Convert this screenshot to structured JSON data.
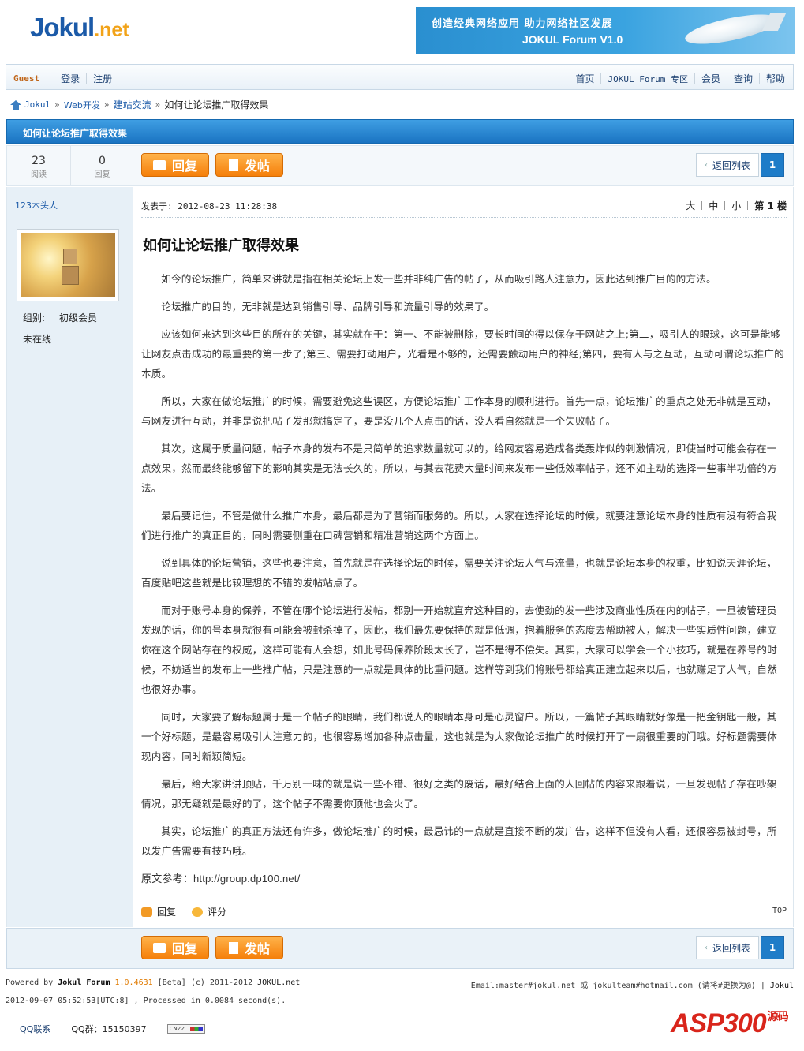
{
  "header": {
    "logo_main": "Jokul",
    "logo_suffix": ".net",
    "banner_line1": "创造经典网络应用   助力网络社区发展",
    "banner_line2": "JOKUL Forum V1.0"
  },
  "navbar": {
    "guest": "Guest",
    "login": "登录",
    "register": "注册",
    "right_items": [
      "首页",
      "JOKUL Forum 专区",
      "会员",
      "查询",
      "帮助"
    ]
  },
  "breadcrumb": {
    "home": "Jokul",
    "items": [
      "Web开发",
      "建站交流"
    ],
    "current": "如何让论坛推广取得效果",
    "separator": "»"
  },
  "thread": {
    "title": "如何让论坛推广取得效果",
    "views": "23",
    "views_label": "阅读",
    "replies": "0",
    "replies_label": "回复",
    "reply_button": "回复",
    "post_button": "发帖",
    "back_button": "返回列表",
    "page": "1"
  },
  "author": {
    "name": "123木头人",
    "group_label": "组别:",
    "group": "初级会员",
    "status": "未在线"
  },
  "post": {
    "meta": "发表于: 2012-08-23 11:28:38",
    "font_big": "大",
    "font_mid": "中",
    "font_small": "小",
    "floor": "第 1 楼",
    "heading": "如何让论坛推广取得效果",
    "paragraphs": [
      "如今的论坛推广，简单来讲就是指在相关论坛上发一些并非纯广告的帖子，从而吸引路人注意力，因此达到推广目的的方法。",
      "论坛推广的目的，无非就是达到销售引导、品牌引导和流量引导的效果了。",
      "应该如何来达到这些目的所在的关键，其实就在于：第一、不能被删除，要长时间的得以保存于网站之上;第二，吸引人的眼球，这可是能够让网友点击成功的最重要的第一步了;第三、需要打动用户，光看是不够的，还需要触动用户的神经;第四，要有人与之互动，互动可谓论坛推广的本质。",
      "所以，大家在做论坛推广的时候，需要避免这些误区，方便论坛推广工作本身的顺利进行。首先一点，论坛推广的重点之处无非就是互动，与网友进行互动，并非是说把帖子发那就搞定了，要是没几个人点击的话，没人看自然就是一个失败帖子。",
      "其次，这属于质量问题，帖子本身的发布不是只简单的追求数量就可以的，给网友容易造成各类轰炸似的刺激情况，即使当时可能会存在一点效果，然而最终能够留下的影响其实是无法长久的，所以，与其去花费大量时间来发布一些低效率帖子，还不如主动的选择一些事半功倍的方法。",
      "最后要记住，不管是做什么推广本身，最后都是为了营销而服务的。所以，大家在选择论坛的时候，就要注意论坛本身的性质有没有符合我们进行推广的真正目的，同时需要侧重在口碑营销和精准营销这两个方面上。",
      "说到具体的论坛营销，这些也要注意，首先就是在选择论坛的时候，需要关注论坛人气与流量，也就是论坛本身的权重，比如说天涯论坛，百度贴吧这些就是比较理想的不错的发帖站点了。",
      "而对于账号本身的保养，不管在哪个论坛进行发帖，都别一开始就直奔这种目的，去使劲的发一些涉及商业性质在内的帖子，一旦被管理员发现的话，你的号本身就很有可能会被封杀掉了，因此，我们最先要保持的就是低调，抱着服务的态度去帮助被人，解决一些实质性问题，建立你在这个网站存在的权威，这样可能有人会想，如此号码保养阶段太长了，岂不是得不偿失。其实，大家可以学会一个小技巧，就是在养号的时候，不妨适当的发布上一些推广帖，只是注意的一点就是具体的比重问题。这样等到我们将账号都给真正建立起来以后，也就赚足了人气，自然也很好办事。",
      "同时，大家要了解标题属于是一个帖子的眼睛，我们都说人的眼睛本身可是心灵窗户。所以，一篇帖子其眼睛就好像是一把金钥匙一般，其一个好标题，是最容易吸引人注意力的，也很容易增加各种点击量，这也就是为大家做论坛推广的时候打开了一扇很重要的门哦。好标题需要体现内容，同时新颖简短。",
      "最后，给大家讲讲顶贴，千万别一味的就是说一些不错、很好之类的废话，最好结合上面的人回帖的内容来跟着说，一旦发现帖子存在吵架情况，那无疑就是最好的了，这个帖子不需要你顶他也会火了。",
      "其实，论坛推广的真正方法还有许多，做论坛推广的时候，最忌讳的一点就是直接不断的发广告，这样不但没有人看，还很容易被封号，所以发广告需要有技巧哦。"
    ],
    "source": "原文参考：http://group.dp100.net/",
    "action_reply": "回复",
    "action_rate": "评分",
    "top": "TOP"
  },
  "footer": {
    "powered": "Powered by ",
    "product": "Jokul Forum",
    "version": " 1.0.4631",
    "rest": " [Beta] (c) 2011-2012 ",
    "site": "JOKUL.net",
    "email": "Email:master#jokul.net 或 jokulteam#hotmail.com (请将#更换为@) | ",
    "email_link": "Jokul",
    "processed": "2012-09-07 05:52:53[UTC:8] , Processed in 0.0084 second(s).",
    "qq_link": "QQ联系",
    "qq_group": "QQ群：15150397",
    "cnzz": "CNZZ"
  },
  "watermark": {
    "main": "ASP300",
    "cn": "源码"
  },
  "colors": {
    "brand_blue": "#1b5aa8",
    "accent_orange": "#f57f0a",
    "title_bar": "#1a74c2"
  }
}
